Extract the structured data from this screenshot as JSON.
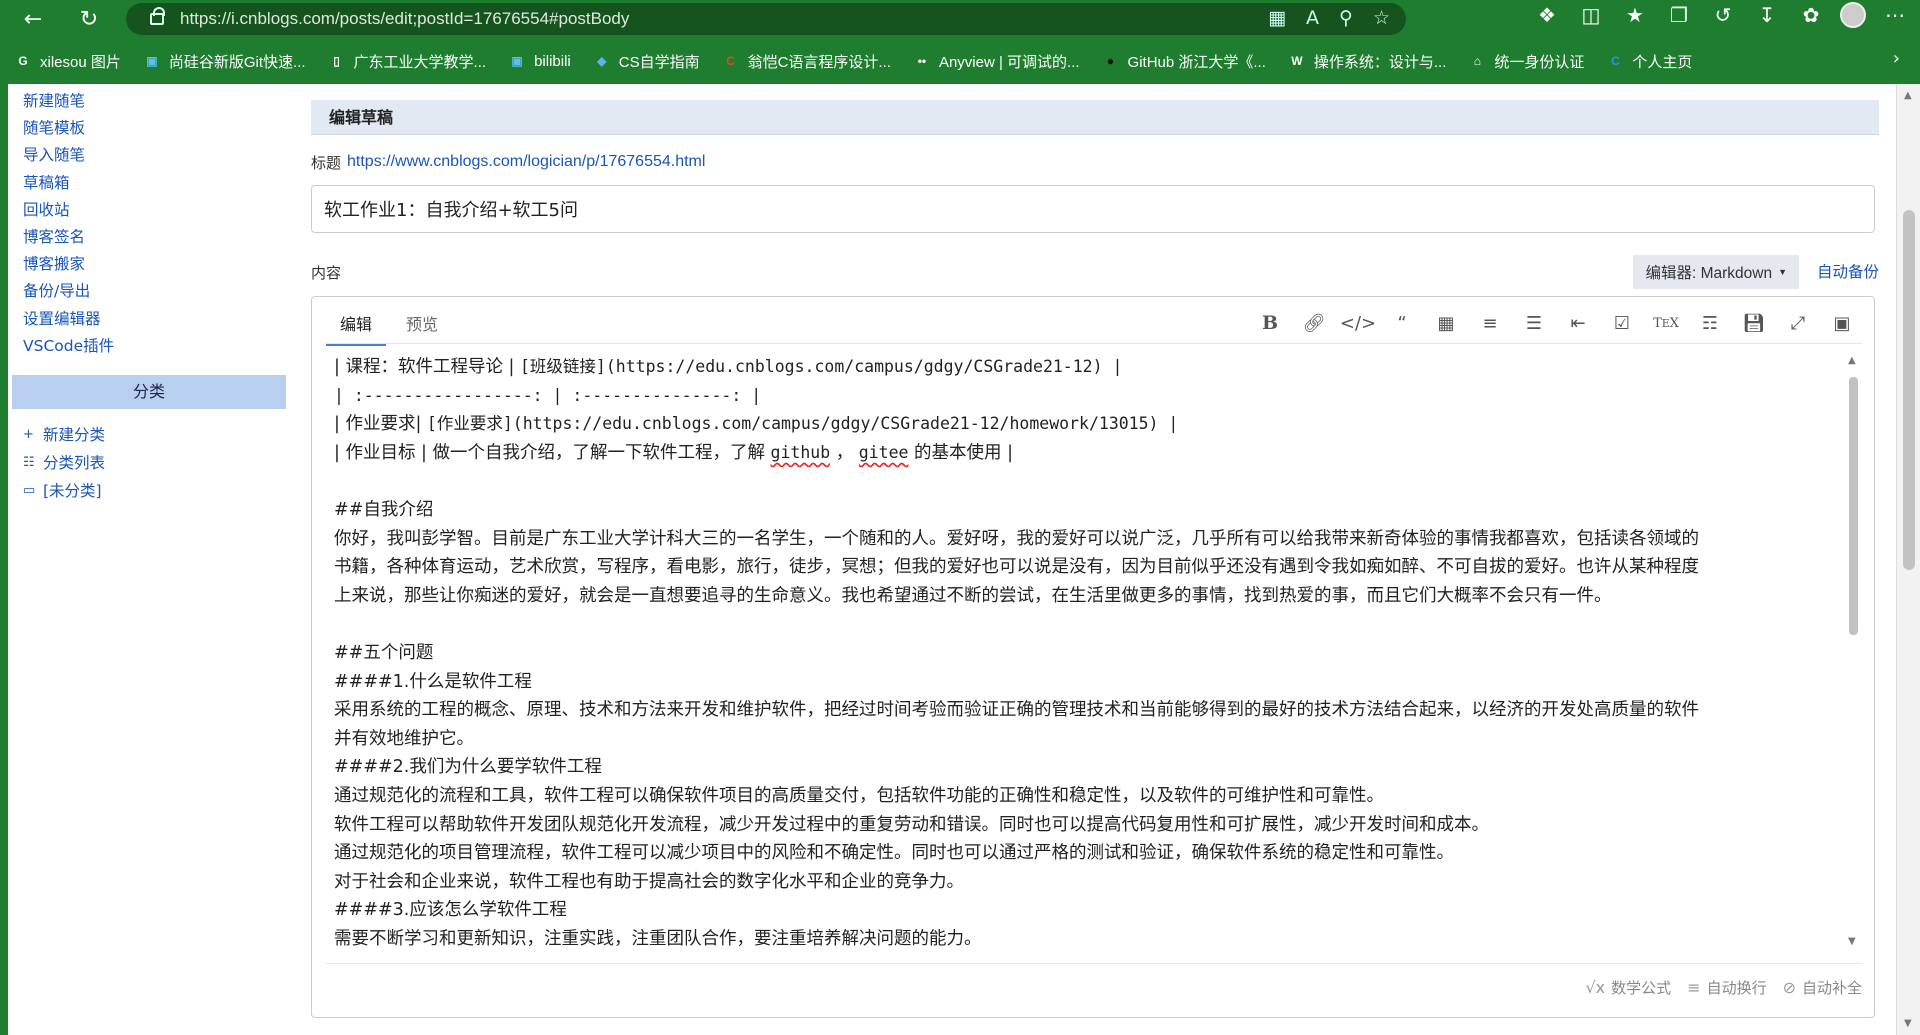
{
  "browser": {
    "url": "https://i.cnblogs.com/posts/edit;postId=17676554#postBody",
    "bookmarks": [
      {
        "label": "xilesou 图片",
        "icon": "google-icon",
        "color": "#ffffff"
      },
      {
        "label": "尚硅谷新版Git快速...",
        "icon": "bilibili-tv-icon",
        "color": "#5bc0f0"
      },
      {
        "label": "广东工业大学教学...",
        "icon": "document-icon",
        "color": "#ffffff"
      },
      {
        "label": "bilibili",
        "icon": "bilibili-tv-icon",
        "color": "#5bc0f0"
      },
      {
        "label": "CS自学指南",
        "icon": "cube-icon",
        "color": "#5ab4f0"
      },
      {
        "label": "翁恺C语言程序设计...",
        "icon": "c-logo-icon",
        "color": "#e8472b"
      },
      {
        "label": "Anyview | 可调试的...",
        "icon": "dots-icon",
        "color": "#ffffff"
      },
      {
        "label": "GitHub 浙江大学《...",
        "icon": "github-icon",
        "color": "#111111"
      },
      {
        "label": "操作系统：设计与...",
        "icon": "w-logo-icon",
        "color": "#ffffff"
      },
      {
        "label": "统一身份认证",
        "icon": "house-icon",
        "color": "#ffffff"
      },
      {
        "label": "个人主页",
        "icon": "c-swirl-icon",
        "color": "#2f8ff0"
      }
    ]
  },
  "sidebar": {
    "items": [
      "新建随笔",
      "随笔模板",
      "导入随笔",
      "草稿箱",
      "回收站",
      "博客签名",
      "博客搬家",
      "备份/导出",
      "设置编辑器",
      "VSCode插件"
    ],
    "category_header": "分类",
    "category_items": [
      {
        "label": "新建分类",
        "icon": "plus-icon"
      },
      {
        "label": "分类列表",
        "icon": "list-icon"
      },
      {
        "label": "[未分类]",
        "icon": "folder-icon"
      }
    ]
  },
  "main": {
    "panel_title": "编辑草稿",
    "title_label": "标题",
    "title_link": "https://www.cnblogs.com/logician/p/17676554.html",
    "title_value": "软工作业1：自我介绍+软工5问",
    "content_label": "内容",
    "editor_select": "编辑器: Markdown",
    "auto_backup": "自动备份",
    "tabs": [
      "编辑",
      "预览"
    ],
    "toolbar": [
      "bold-icon",
      "link-icon",
      "code-icon",
      "quote-icon",
      "table-icon",
      "bullet-list-icon",
      "numbered-list-icon",
      "indent-icon",
      "checkbox-icon",
      "tex-icon",
      "toc-icon",
      "save-icon",
      "fullscreen-icon",
      "image-icon"
    ],
    "footer": [
      "数学公式",
      "自动换行",
      "自动补全"
    ]
  },
  "content": {
    "line1a": "| 课程：软件工程导论 | ",
    "line1b": "[班级链接](https://edu.cnblogs.com/campus/gdgy/CSGrade21-12) |",
    "line2": "| :-----------------: | :---------------: |",
    "line3a": "| 作业要求| ",
    "line3b": "[作业要求](https://edu.cnblogs.com/campus/gdgy/CSGrade21-12/homework/13015) |",
    "line4a": "| 作业目标 | 做一个自我介绍，了解一下软件工程，了解 ",
    "line4b": "github",
    "line4c": " ， ",
    "line4d": "gitee",
    "line4e": " 的基本使用 |",
    "line6": "##自我介绍",
    "line7": "你好，我叫彭学智。目前是广东工业大学计科大三的一名学生，一个随和的人。爱好呀，我的爱好可以说广泛，几乎所有可以给我带来新奇体验的事情我都喜欢，包括读各领域的",
    "line8": "书籍，各种体育运动，艺术欣赏，写程序，看电影，旅行，徒步，冥想；但我的爱好也可以说是没有，因为目前似乎还没有遇到令我如痴如醉、不可自拔的爱好。也许从某种程度",
    "line9": "上来说，那些让你痴迷的爱好，就会是一直想要追寻的生命意义。我也希望通过不断的尝试，在生活里做更多的事情，找到热爱的事，而且它们大概率不会只有一件。",
    "line11": "##五个问题",
    "line12": "####1.什么是软件工程",
    "line13": "采用系统的工程的概念、原理、技术和方法来开发和维护软件，把经过时间考验而验证正确的管理技术和当前能够得到的最好的技术方法结合起来，以经济的开发处高质量的软件",
    "line14": "并有效地维护它。",
    "line15": "####2.我们为什么要学软件工程",
    "line16": "通过规范化的流程和工具，软件工程可以确保软件项目的高质量交付，包括软件功能的正确性和稳定性，以及软件的可维护性和可靠性。",
    "line17": "软件工程可以帮助软件开发团队规范化开发流程，减少开发过程中的重复劳动和错误。同时也可以提高代码复用性和可扩展性，减少开发时间和成本。",
    "line18": "通过规范化的项目管理流程，软件工程可以减少项目中的风险和不确定性。同时也可以通过严格的测试和验证，确保软件系统的稳定性和可靠性。",
    "line19": "对于社会和企业来说，软件工程也有助于提高社会的数字化水平和企业的竞争力。",
    "line20": "####3.应该怎么学软件工程",
    "line21": "需要不断学习和更新知识，注重实践，注重团队合作，要注重培养解决问题的能力。"
  }
}
